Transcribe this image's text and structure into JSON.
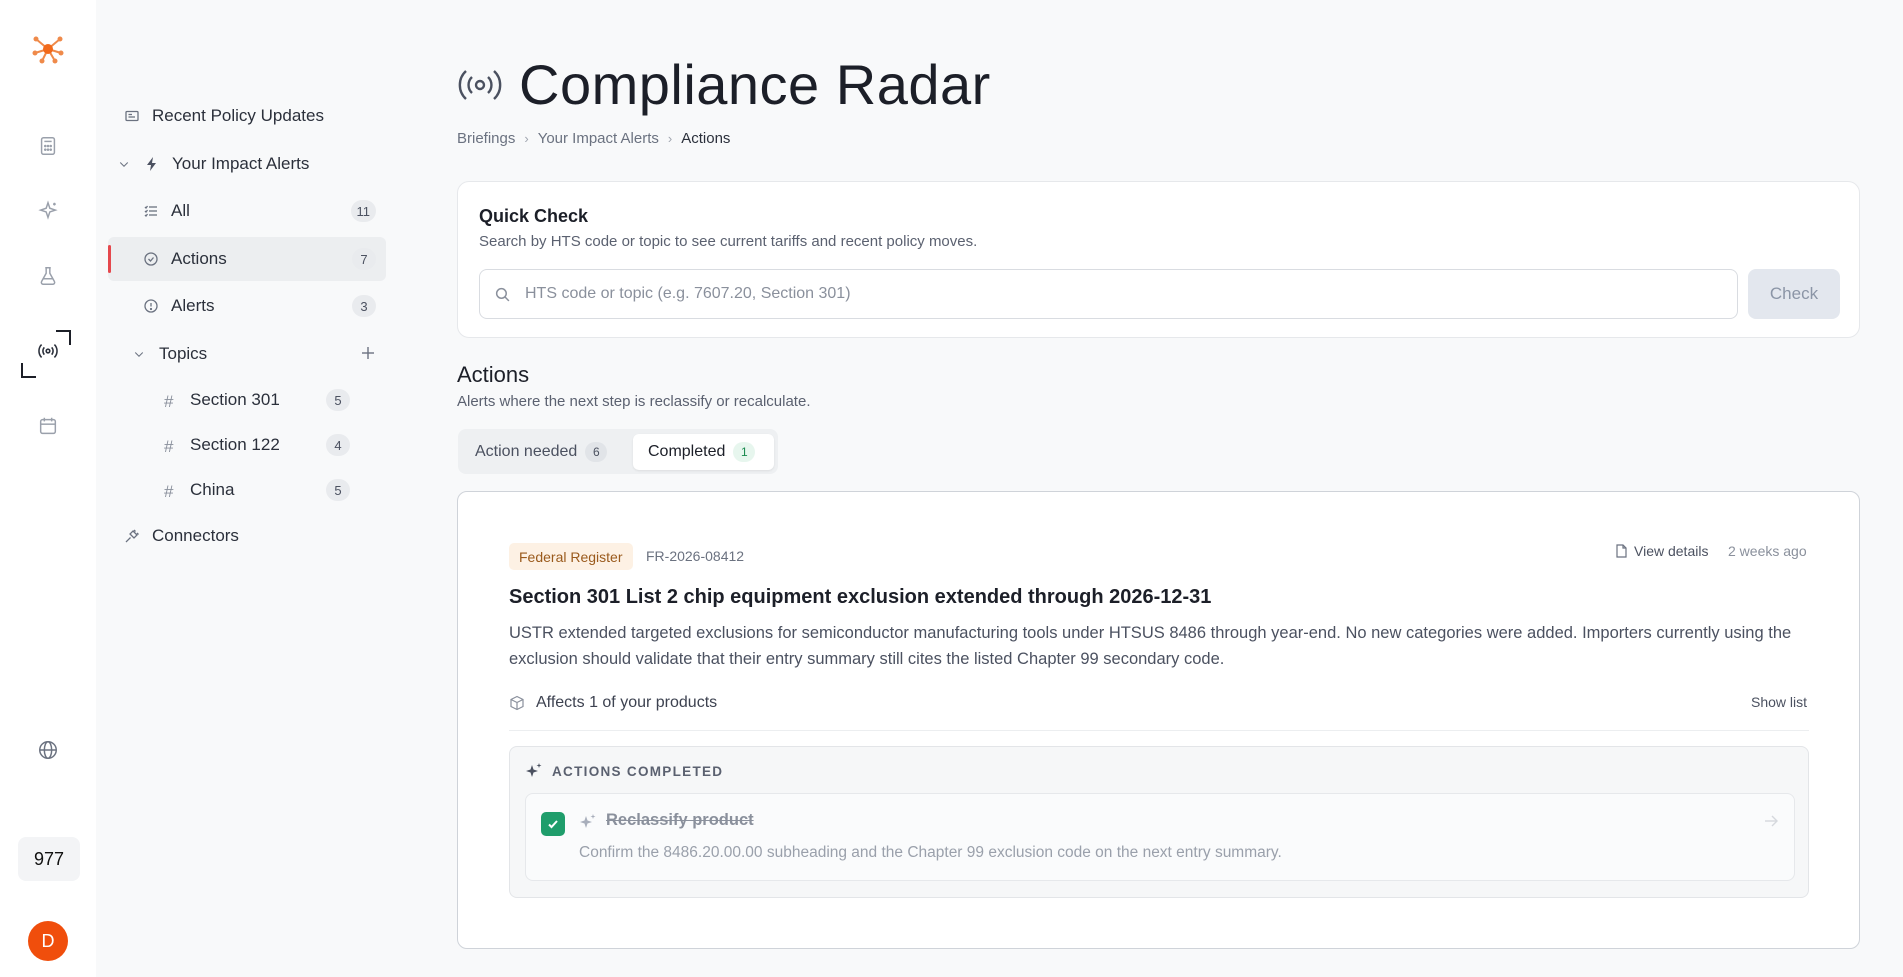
{
  "rail": {
    "count": "977",
    "avatar_initial": "D"
  },
  "sidebar": {
    "recent": "Recent Policy Updates",
    "impact_alerts": "Your Impact Alerts",
    "items": [
      {
        "label": "All",
        "count": "11"
      },
      {
        "label": "Actions",
        "count": "7"
      },
      {
        "label": "Alerts",
        "count": "3"
      }
    ],
    "topics_label": "Topics",
    "topics": [
      {
        "label": "Section 301",
        "count": "5"
      },
      {
        "label": "Section 122",
        "count": "4"
      },
      {
        "label": "China",
        "count": "5"
      }
    ],
    "connectors": "Connectors"
  },
  "header": {
    "title": "Compliance Radar",
    "breadcrumb": [
      "Briefings",
      "Your Impact Alerts",
      "Actions"
    ]
  },
  "quick_check": {
    "title": "Quick Check",
    "subtitle": "Search by HTS code or topic to see current tariffs and recent policy moves.",
    "placeholder": "HTS code or topic (e.g. 7607.20, Section 301)",
    "button": "Check"
  },
  "actions": {
    "title": "Actions",
    "subtitle": "Alerts where the next step is reclassify or recalculate.",
    "tabs": [
      {
        "label": "Action needed",
        "count": "6"
      },
      {
        "label": "Completed",
        "count": "1"
      }
    ]
  },
  "alert": {
    "source": "Federal Register",
    "doc_id": "FR-2026-08412",
    "view_details": "View details",
    "time_ago": "2 weeks ago",
    "title": "Section 301 List 2 chip equipment exclusion extended through 2026-12-31",
    "body": "USTR extended targeted exclusions for semiconductor manufacturing tools under HTSUS 8486 through year-end. No new categories were added. Importers currently using the exclusion should validate that their entry summary still cites the listed Chapter 99 secondary code.",
    "affects": "Affects 1 of your products",
    "show_list": "Show list",
    "completed_heading": "ACTIONS COMPLETED",
    "action_title": "Reclassify product",
    "action_desc": "Confirm the 8486.20.00.00 subheading and the Chapter 99 exclusion code on the next entry summary."
  },
  "colors": {
    "accent_orange": "#f04e0c",
    "active_marker": "#e5484d",
    "check_green": "#1f9d6b",
    "source_badge_bg": "#fdf1e4"
  }
}
